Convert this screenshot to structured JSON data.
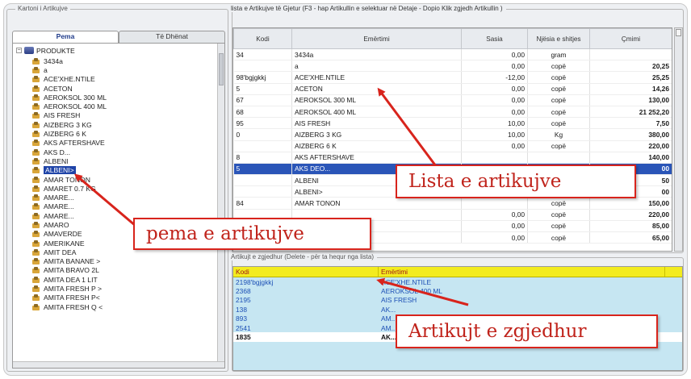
{
  "left_panel": {
    "title": "Kartoni i Artikujve",
    "tabs": [
      "Pema",
      "Të Dhënat"
    ],
    "root_label": "PRODUKTE",
    "items": [
      "3434a",
      "a",
      "ACE'XHE.NTILE",
      "ACETON",
      "AEROKSOL 300 ML",
      "AEROKSOL 400 ML",
      "AIS FRESH",
      "AIZBERG 3 KG",
      "AIZBERG 6 K",
      "AKS AFTERSHAVE",
      "AKS D...",
      "ALBENI",
      "ALBENI>",
      "AMAR TONON",
      "AMARET 0.7 KG",
      "AMARE...",
      "AMARE...",
      "AMARE...",
      "AMARO",
      "AMAVERDE",
      "AMERIKANE",
      "AMIT DEA",
      "AMITA BANANE >",
      "AMITA BRAVO 2L",
      "AMITA DEA 1 LIT",
      "AMITA FRESH P >",
      "AMITA FRESH P<",
      "AMITA FRESH Q <"
    ],
    "selected_index": 12
  },
  "list_panel": {
    "title": "lista e Artikujve të Gjetur   (F3 - hap Artikullin e selektuar në Detaje  -  Dopio Klik zgjedh Artikullin )",
    "columns": [
      "Kodi",
      "Emërtimi",
      "Sasia",
      "Njësia e shitjes",
      "Çmimi"
    ],
    "rows": [
      {
        "kodi": "34",
        "emertimi": "3434a",
        "sasia": "0,00",
        "njesia": "gram",
        "cmimi": ""
      },
      {
        "kodi": "",
        "emertimi": "a",
        "sasia": "0,00",
        "njesia": "copë",
        "cmimi": "20,25"
      },
      {
        "kodi": "98'bgjgkkj",
        "emertimi": "ACE'XHE.NTILE",
        "sasia": "-12,00",
        "njesia": "copë",
        "cmimi": "25,25"
      },
      {
        "kodi": "5",
        "emertimi": "ACETON",
        "sasia": "0,00",
        "njesia": "copë",
        "cmimi": "14,26"
      },
      {
        "kodi": "67",
        "emertimi": "AEROKSOL 300 ML",
        "sasia": "0,00",
        "njesia": "copë",
        "cmimi": "130,00"
      },
      {
        "kodi": "68",
        "emertimi": "AEROKSOL 400 ML",
        "sasia": "0,00",
        "njesia": "copë",
        "cmimi": "21 252,20"
      },
      {
        "kodi": "95",
        "emertimi": "AIS FRESH",
        "sasia": "10,00",
        "njesia": "copë",
        "cmimi": "7,50"
      },
      {
        "kodi": "0",
        "emertimi": "AIZBERG 3 KG",
        "sasia": "10,00",
        "njesia": "Kg",
        "cmimi": "380,00"
      },
      {
        "kodi": "",
        "emertimi": "AIZBERG 6 K",
        "sasia": "0,00",
        "njesia": "copë",
        "cmimi": "220,00"
      },
      {
        "kodi": "8",
        "emertimi": "AKS AFTERSHAVE",
        "sasia": "",
        "njesia": "",
        "cmimi": "140,00"
      },
      {
        "kodi": "5",
        "emertimi": "AKS DEO...",
        "sasia": "",
        "njesia": "",
        "cmimi": "00"
      },
      {
        "kodi": "",
        "emertimi": "ALBENI",
        "sasia": "",
        "njesia": "",
        "cmimi": "50"
      },
      {
        "kodi": "",
        "emertimi": "ALBENI>",
        "sasia": "",
        "njesia": "",
        "cmimi": "00"
      },
      {
        "kodi": "84",
        "emertimi": "AMAR TONON",
        "sasia": "",
        "njesia": "copë",
        "cmimi": "150,00"
      },
      {
        "kodi": "",
        "emertimi": "",
        "sasia": "0,00",
        "njesia": "copë",
        "cmimi": "220,00"
      },
      {
        "kodi": "",
        "emertimi": "",
        "sasia": "0,00",
        "njesia": "copë",
        "cmimi": "85,00"
      },
      {
        "kodi": "",
        "emertimi": "",
        "sasia": "0,00",
        "njesia": "copë",
        "cmimi": "65,00"
      }
    ],
    "selected_row": 10
  },
  "selected_panel": {
    "title": "Artikujt e zgjedhur   (Delete - për ta hequr nga lista)",
    "columns": [
      "Kodi",
      "Emërtimi"
    ],
    "rows": [
      {
        "kodi": "2198'bgjgkkj",
        "emertimi": "ACE'XHE.NTILE"
      },
      {
        "kodi": "2368",
        "emertimi": "AEROKSOL 400 ML"
      },
      {
        "kodi": "2195",
        "emertimi": "AIS FRESH"
      },
      {
        "kodi": "138",
        "emertimi": "AK..."
      },
      {
        "kodi": "893",
        "emertimi": "AM..."
      },
      {
        "kodi": "2541",
        "emertimi": "AM..."
      },
      {
        "kodi": "1835",
        "emertimi": "AK..."
      }
    ]
  },
  "annotations": {
    "list_callout": "Lista e artikujve",
    "tree_callout": "pema e artikujve",
    "selected_callout": "Artikujt e zgjedhur",
    "color": "#d8241c"
  }
}
